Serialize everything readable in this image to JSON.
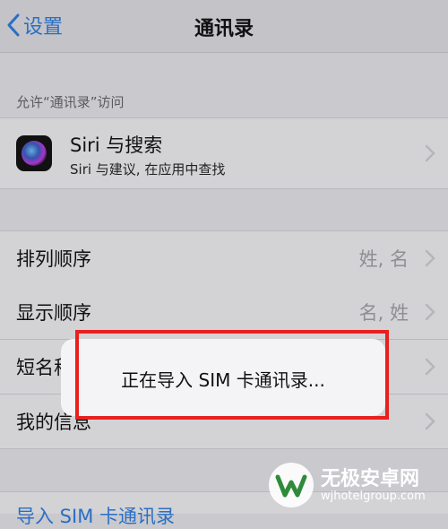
{
  "nav": {
    "back_label": "设置",
    "title": "通讯录"
  },
  "access_section": {
    "header": "允许“通讯录”访问"
  },
  "siri": {
    "title": "Siri 与搜索",
    "subtitle": "Siri 与建议, 在应用中查找"
  },
  "rows": [
    {
      "label": "排列顺序",
      "value": "姓, 名"
    },
    {
      "label": "显示顺序",
      "value": "名, 姓"
    },
    {
      "label": "短名称",
      "value": ""
    },
    {
      "label": "我的信息",
      "value": ""
    }
  ],
  "bottom_link": "导入 SIM 卡通讯录",
  "overlay": {
    "message": "正在导入 SIM 卡通讯录..."
  },
  "watermark": {
    "title": "无极安卓网",
    "url": "wjhotelgroup.com"
  },
  "colors": {
    "accent": "#2a6fc4",
    "highlight": "#e8201e",
    "background": "#c9c9ce"
  }
}
